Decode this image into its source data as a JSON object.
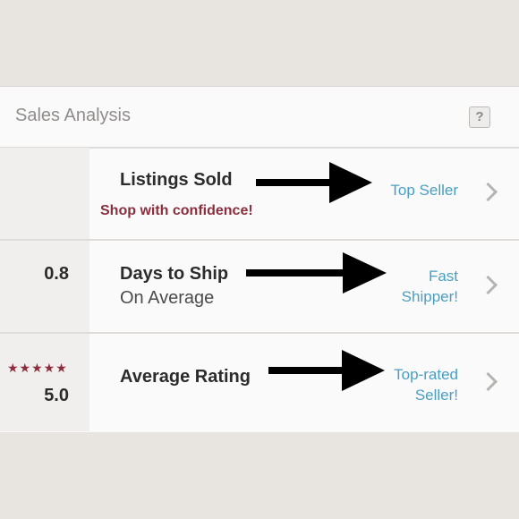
{
  "header": {
    "title": "Sales Analysis",
    "help_label": "?"
  },
  "rows": [
    {
      "label": "Listings Sold",
      "promo": "Shop with confidence!",
      "badge": "Top Seller"
    },
    {
      "stat": "0.8",
      "label": "Days to Ship",
      "sublabel": "On Average",
      "badge_line1": "Fast",
      "badge_line2": "Shipper!"
    },
    {
      "stars": "★★★★★",
      "rating": 5,
      "stat": "5.0",
      "label": "Average Rating",
      "badge_line1": "Top-rated",
      "badge_line2": "Seller!"
    }
  ],
  "colors": {
    "accent_link": "#4a9fc0",
    "promo": "#8b2e3d",
    "star": "#8d2c3a"
  },
  "icons": [
    "help-icon",
    "chevron-right-icon",
    "arrow-right-icon",
    "star-icon"
  ]
}
